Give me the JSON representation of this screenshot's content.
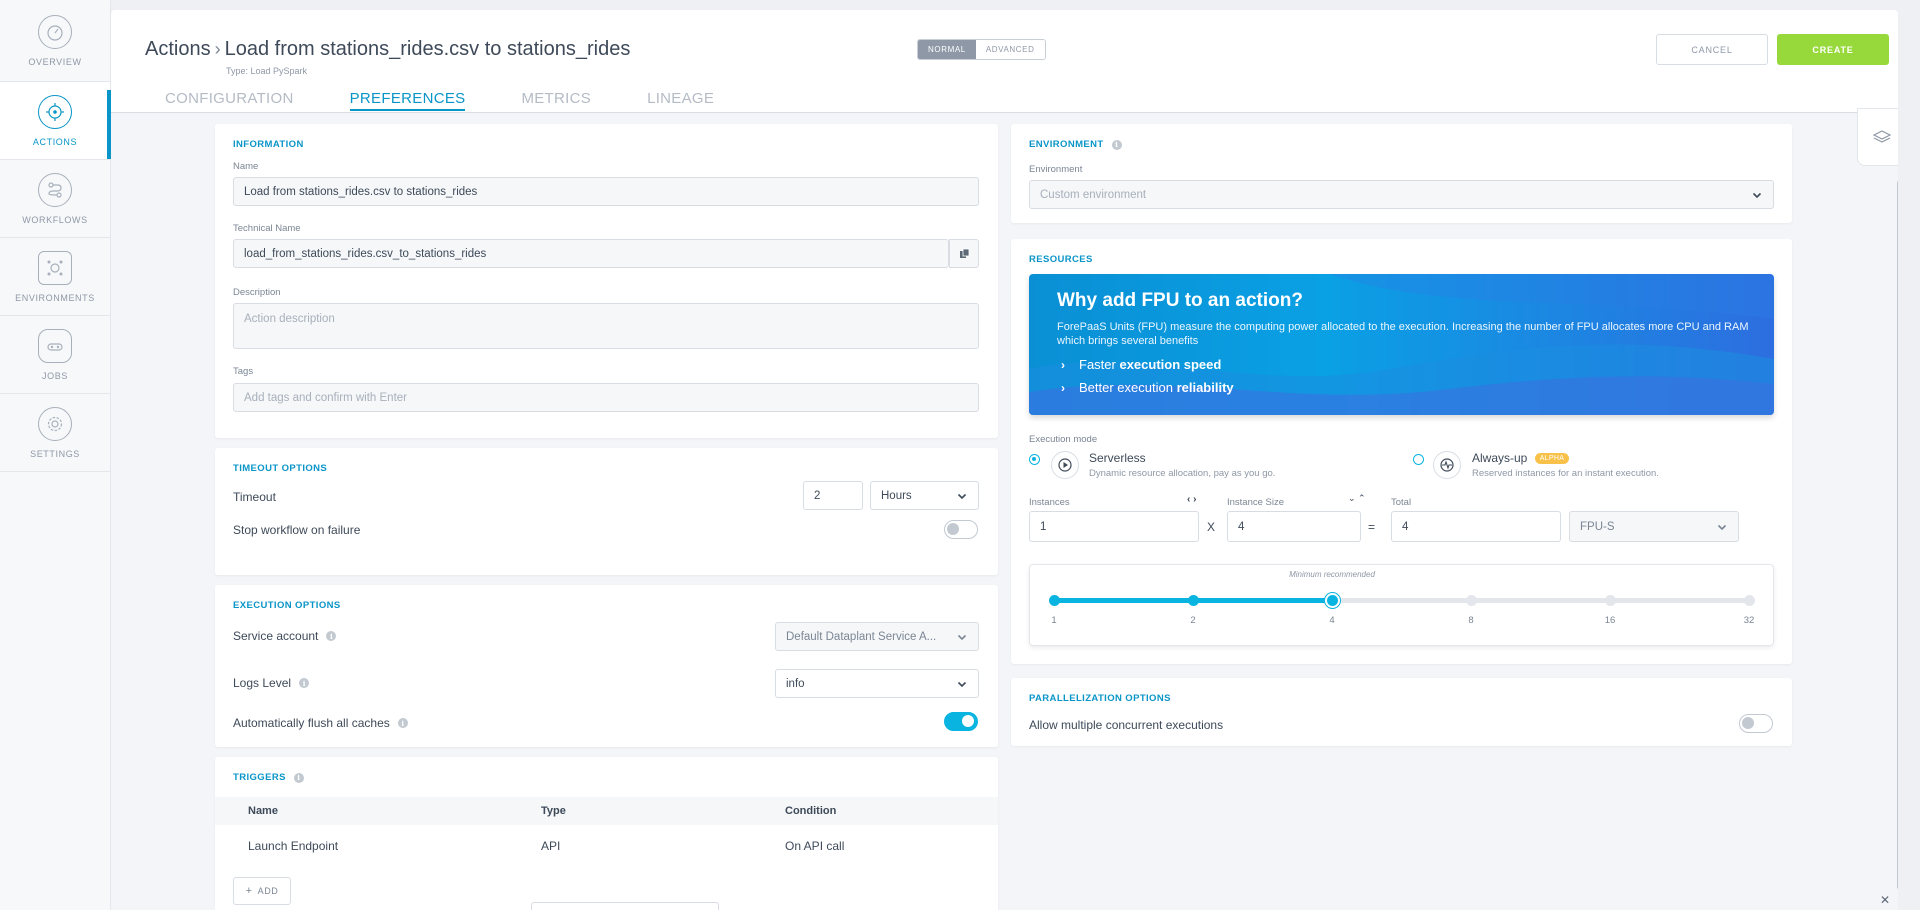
{
  "sidebar": {
    "items": [
      {
        "label": "OVERVIEW",
        "icon": "gauge-icon"
      },
      {
        "label": "ACTIONS",
        "icon": "target-icon",
        "active": true
      },
      {
        "label": "WORKFLOWS",
        "icon": "workflow-icon"
      },
      {
        "label": "ENVIRONMENTS",
        "icon": "environment-icon"
      },
      {
        "label": "JOBS",
        "icon": "jobs-icon"
      },
      {
        "label": "SETTINGS",
        "icon": "gear-icon"
      }
    ]
  },
  "header": {
    "breadcrumb_root": "Actions",
    "title": "Load from stations_rides.csv to stations_rides",
    "type_line": "Type: Load PySpark",
    "mode_normal": "NORMAL",
    "mode_advanced": "ADVANCED",
    "cancel_label": "CANCEL",
    "create_label": "CREATE",
    "tabs": [
      "CONFIGURATION",
      "PREFERENCES",
      "METRICS",
      "LINEAGE"
    ],
    "active_tab": "PREFERENCES"
  },
  "information": {
    "title": "INFORMATION",
    "name_label": "Name",
    "name_value": "Load from stations_rides.csv to stations_rides",
    "technical_label": "Technical Name",
    "technical_value": "load_from_stations_rides.csv_to_stations_rides",
    "description_label": "Description",
    "description_placeholder": "Action description",
    "tags_label": "Tags",
    "tags_placeholder": "Add tags and confirm with Enter"
  },
  "timeout": {
    "title": "TIMEOUT OPTIONS",
    "timeout_label": "Timeout",
    "timeout_value": "2",
    "unit_value": "Hours",
    "stop_label": "Stop workflow on failure",
    "stop_enabled": false
  },
  "execution": {
    "title": "EXECUTION OPTIONS",
    "service_account_label": "Service account",
    "service_account_value": "Default Dataplant Service A...",
    "logs_label": "Logs Level",
    "logs_value": "info",
    "flush_label": "Automatically flush all caches",
    "flush_enabled": true
  },
  "triggers": {
    "title": "TRIGGERS",
    "columns": [
      "Name",
      "Type",
      "Condition"
    ],
    "rows": [
      [
        "Launch Endpoint",
        "API",
        "On API call"
      ]
    ],
    "add_label": "ADD"
  },
  "environment": {
    "title": "ENVIRONMENT",
    "env_label": "Environment",
    "env_placeholder": "Custom environment"
  },
  "resources": {
    "title": "RESOURCES",
    "banner_title": "Why add FPU to an action?",
    "banner_desc": "ForePaaS Units (FPU) measure the computing power allocated to the execution. Increasing the number of FPU allocates more CPU and RAM which brings several benefits",
    "point1_plain": "Faster ",
    "point1_bold": "execution speed",
    "point2_plain": "Better execution ",
    "point2_bold": "reliability",
    "exec_mode_label": "Execution mode",
    "serverless_name": "Serverless",
    "serverless_desc": "Dynamic resource allocation, pay as you go.",
    "alwaysup_name": "Always-up",
    "alwaysup_badge": "ALPHA",
    "alwaysup_desc": "Reserved instances for an instant execution.",
    "selected_mode": "Serverless",
    "instances_label": "Instances",
    "instances_value": "1",
    "times": "X",
    "size_label": "Instance Size",
    "size_value": "4",
    "equals": "=",
    "total_label": "Total",
    "total_value": "4",
    "unit_value": "FPU-S",
    "min_recommended": "Minimum recommended",
    "slider_ticks": [
      "1",
      "2",
      "4",
      "8",
      "16",
      "32"
    ],
    "slider_selected_index": 2,
    "accent": "#0ab4e0"
  },
  "parallelization": {
    "title": "PARALLELIZATION OPTIONS",
    "concurrent_label": "Allow multiple concurrent executions",
    "concurrent_enabled": false
  },
  "colors": {
    "accent": "#0a95c8",
    "create": "#97d93a",
    "toggle_on": "#0ab4e0"
  }
}
